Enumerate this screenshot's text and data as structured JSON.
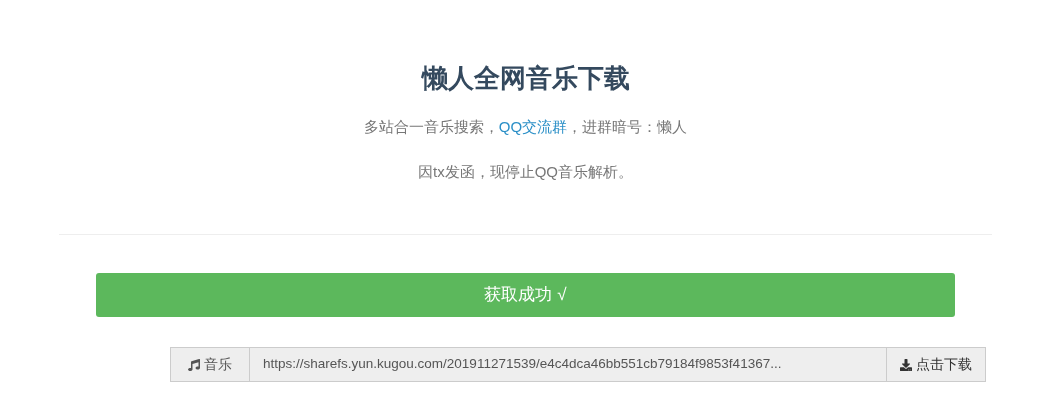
{
  "title": "懒人全网音乐下载",
  "intro": {
    "before": "多站合一音乐搜索，",
    "link": "QQ交流群",
    "after": "，进群暗号：懒人"
  },
  "notice": "因tx发函，现停止QQ音乐解析。",
  "status_banner": "获取成功 √",
  "result": {
    "label": "音乐",
    "url": "https://sharefs.yun.kugou.com/201911271539/e4c4dca46bb551cb79184f9853f41367...",
    "download": "点击下载"
  }
}
